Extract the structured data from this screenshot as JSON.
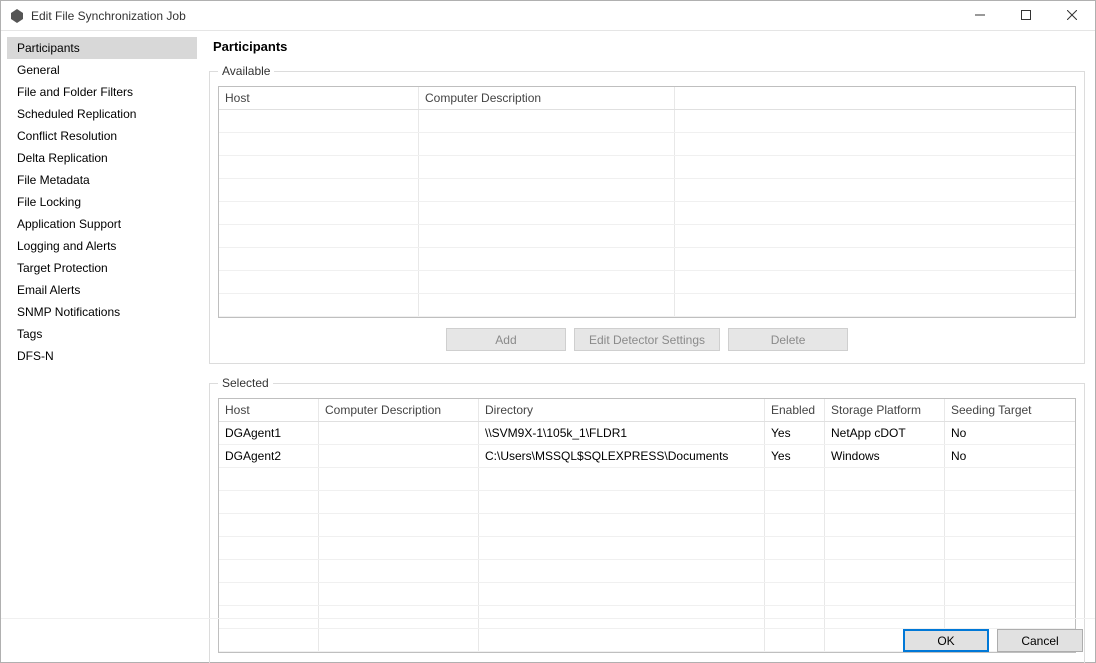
{
  "window": {
    "title": "Edit File Synchronization Job"
  },
  "sidebar": {
    "selected_index": 0,
    "items": [
      {
        "label": "Participants"
      },
      {
        "label": "General"
      },
      {
        "label": "File and Folder Filters"
      },
      {
        "label": "Scheduled Replication"
      },
      {
        "label": "Conflict Resolution"
      },
      {
        "label": "Delta Replication"
      },
      {
        "label": "File Metadata"
      },
      {
        "label": "File Locking"
      },
      {
        "label": "Application Support"
      },
      {
        "label": "Logging and Alerts"
      },
      {
        "label": "Target Protection"
      },
      {
        "label": "Email Alerts"
      },
      {
        "label": "SNMP Notifications"
      },
      {
        "label": "Tags"
      },
      {
        "label": "DFS-N"
      }
    ]
  },
  "main": {
    "heading": "Participants",
    "available": {
      "legend": "Available",
      "columns": {
        "host": "Host",
        "desc": "Computer Description"
      },
      "rows": [],
      "blank_row_count": 9
    },
    "buttons": {
      "add": "Add",
      "edit_detector": "Edit Detector Settings",
      "delete": "Delete"
    },
    "selected": {
      "legend": "Selected",
      "columns": {
        "host": "Host",
        "desc": "Computer Description",
        "dir": "Directory",
        "enabled": "Enabled",
        "platform": "Storage Platform",
        "seeding": "Seeding Target"
      },
      "rows": [
        {
          "host": "DGAgent1",
          "desc": "",
          "dir": "\\\\SVM9X-1\\105k_1\\FLDR1",
          "enabled": "Yes",
          "platform": "NetApp cDOT",
          "seeding": "No"
        },
        {
          "host": "DGAgent2",
          "desc": "",
          "dir": "C:\\Users\\MSSQL$SQLEXPRESS\\Documents",
          "enabled": "Yes",
          "platform": "Windows",
          "seeding": "No"
        }
      ],
      "blank_row_count": 8
    }
  },
  "footer": {
    "ok": "OK",
    "cancel": "Cancel"
  }
}
